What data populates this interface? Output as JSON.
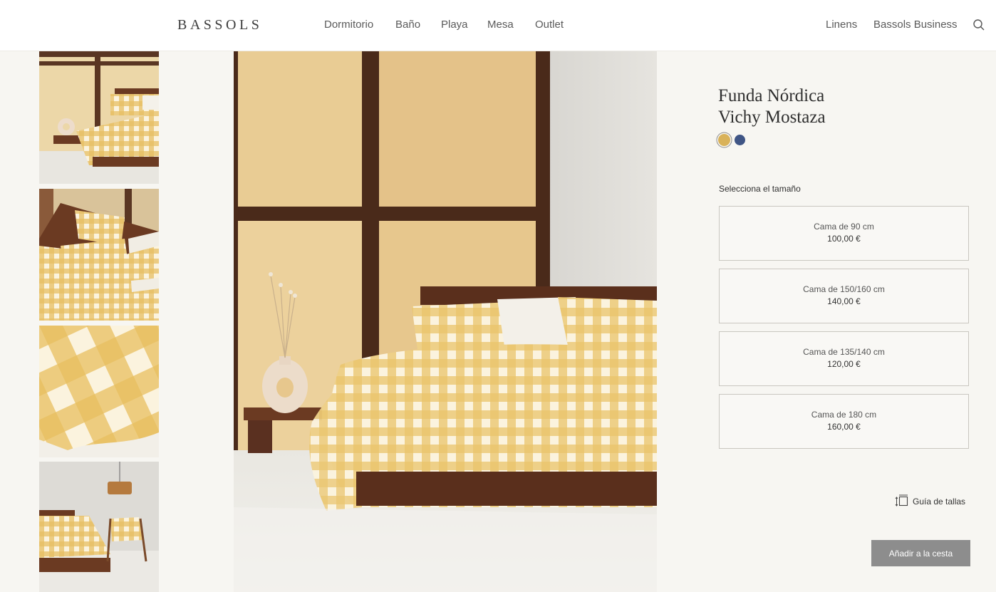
{
  "header": {
    "logo": "BASSOLS",
    "nav_left": [
      "Dormitorio",
      "Baño",
      "Playa",
      "Mesa",
      "Outlet"
    ],
    "nav_right": [
      "Linens",
      "Bassols Business"
    ],
    "search_icon": "search-icon"
  },
  "gallery": {
    "thumbnails": [
      "bedroom-scene",
      "pillows-closeup",
      "fabric-closeup",
      "bedroom-with-chair"
    ],
    "main_image": "bedroom-scene"
  },
  "product": {
    "title_line1": "Funda Nórdica",
    "title_line2": "Vichy Mostaza",
    "colors": [
      {
        "name": "mustard",
        "hex": "#d9b25a",
        "selected": true
      },
      {
        "name": "navy",
        "hex": "#3f5585",
        "selected": false
      }
    ],
    "size_label": "Selecciona el tamaño",
    "sizes": [
      {
        "name": "Cama de 90 cm",
        "price": "100,00 €"
      },
      {
        "name": "Cama de 150/160 cm",
        "price": "140,00 €"
      },
      {
        "name": "Cama de 135/140 cm",
        "price": "120,00 €"
      },
      {
        "name": "Cama de 180 cm",
        "price": "160,00 €"
      }
    ],
    "size_guide": "Guía de tallas",
    "add_to_cart": "Añadir a la cesta"
  },
  "colors": {
    "gingham": "#e9c46a",
    "wall": "#e7c98f",
    "frame": "#4a2a1a",
    "button_bg": "#8d8d8d"
  }
}
